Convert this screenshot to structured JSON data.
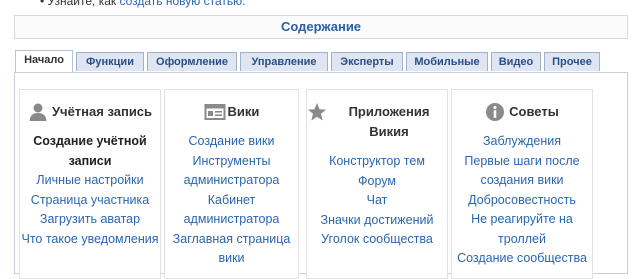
{
  "top_fragment": {
    "prefix": "• Узнайте, как ",
    "link": "создать новую статью."
  },
  "contents": {
    "title": "Содержание"
  },
  "tabs": [
    {
      "label": "Начало",
      "active": true
    },
    {
      "label": "Функции",
      "active": false
    },
    {
      "label": "Оформление",
      "active": false
    },
    {
      "label": "Управление",
      "active": false
    },
    {
      "label": "Эксперты",
      "active": false
    },
    {
      "label": "Мобильные",
      "active": false
    },
    {
      "label": "Видео",
      "active": false
    },
    {
      "label": "Прочее",
      "active": false
    }
  ],
  "columns": [
    {
      "title": "Учётная запись",
      "icon": "user-icon",
      "current": "Создание учётной записи",
      "links": [
        "Личные настройки",
        "Страница участника",
        "Загрузить аватар",
        "Что такое уведомления"
      ]
    },
    {
      "title": "Вики",
      "icon": "window-icon",
      "links": [
        "Создание вики",
        "Инструменты администратора",
        "Кабинет администратора",
        "Заглавная страница вики"
      ]
    },
    {
      "title": "Приложения Викия",
      "icon": "star-icon",
      "links": [
        "Конструктор тем",
        "Форум",
        "Чат",
        "Значки достижений",
        "Уголок сообщества"
      ]
    },
    {
      "title": "Советы",
      "icon": "info-icon",
      "links": [
        "Заблуждения",
        "Первые шаги после создания вики",
        "Добросовестность",
        "Не реагируйте на троллей",
        "Создание сообщества"
      ]
    }
  ],
  "colors": {
    "link": "#2a66b0",
    "tab_bg": "#dfe6f1",
    "tab_text": "#2a4f86"
  }
}
